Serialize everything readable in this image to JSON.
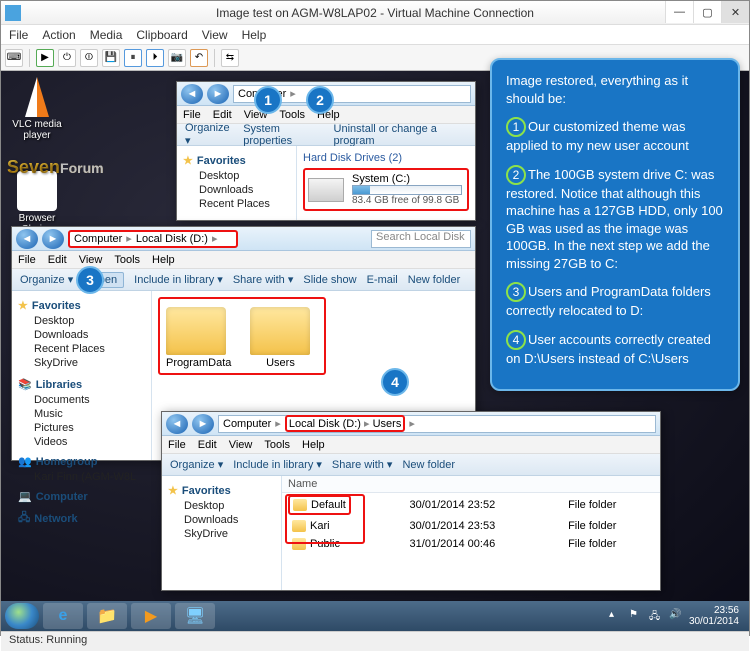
{
  "vm": {
    "title": "Image test on AGM-W8LAP02 - Virtual Machine Connection",
    "menu": [
      "File",
      "Action",
      "Media",
      "Clipboard",
      "View",
      "Help"
    ],
    "status": "Status: Running"
  },
  "desktop": {
    "icons": [
      {
        "label": "VLC media player"
      },
      {
        "label": "Browser Choice"
      }
    ],
    "brand": "Seven",
    "brand_tail": "Forum"
  },
  "taskbar": {
    "apps": [
      "ie",
      "explorer",
      "wmp",
      "vm"
    ],
    "time": "23:56",
    "date": "30/01/2014"
  },
  "explorer_computer": {
    "loc_prefix": "Computer",
    "search": "",
    "menu": [
      "File",
      "Edit",
      "View",
      "Tools",
      "Help"
    ],
    "cmd": [
      "Organize",
      "System properties",
      "Uninstall or change a program"
    ],
    "favorites_hdr": "Favorites",
    "fav_items": [
      "Desktop",
      "Downloads",
      "Recent Places"
    ],
    "section": "Hard Disk Drives (2)",
    "drive_name": "System (C:)",
    "drive_sub": "83.4 GB free of 99.8 GB",
    "drive_fill_pct": 16
  },
  "explorer_d": {
    "loc_segments": [
      "Computer",
      "Local Disk (D:)"
    ],
    "search_ph": "Search Local Disk",
    "menu": [
      "File",
      "Edit",
      "View",
      "Tools",
      "Help"
    ],
    "cmd": {
      "organize": "Organize",
      "open": "Open",
      "include": "Include in library",
      "share": "Share with",
      "slideshow": "Slide show",
      "email": "E-mail",
      "newfolder": "New folder"
    },
    "favorites_hdr": "Favorites",
    "fav_items": [
      "Desktop",
      "Downloads",
      "Recent Places",
      "SkyDrive"
    ],
    "libraries_hdr": "Libraries",
    "lib_items": [
      "Documents",
      "Music",
      "Pictures",
      "Videos"
    ],
    "homegroup_hdr": "Homegroup",
    "homegroup_items": [
      "Kari Finn (AGM-W8L"
    ],
    "computer_hdr": "Computer",
    "network_hdr": "Network",
    "folders": [
      "ProgramData",
      "Users"
    ]
  },
  "explorer_users": {
    "loc_segments": [
      "Computer",
      "Local Disk (D:)",
      "Users"
    ],
    "menu": [
      "File",
      "Edit",
      "View",
      "Tools",
      "Help"
    ],
    "cmd": {
      "organize": "Organize",
      "include": "Include in library",
      "share": "Share with",
      "newfolder": "New folder"
    },
    "favorites_hdr": "Favorites",
    "fav_items": [
      "Desktop",
      "Downloads",
      "SkyDrive"
    ],
    "col_name": "Name",
    "rows": [
      {
        "name": "Default",
        "date": "30/01/2014 23:52",
        "type": "File folder"
      },
      {
        "name": "Kari",
        "date": "30/01/2014 23:53",
        "type": "File folder"
      },
      {
        "name": "Public",
        "date": "31/01/2014 00:46",
        "type": "File folder"
      }
    ]
  },
  "callout": {
    "intro": "Image restored, everything as it should be:",
    "p1": "Our customized theme was applied to my new user account",
    "p2": "The 100GB system drive C: was restored. Notice that although this machine has a 127GB HDD, only 100 GB was used as the image was 100GB. In the next step we add the missing 27GB to C:",
    "p3": "Users and ProgramData folders correctly relocated to D:",
    "p4": "User accounts correctly created on D:\\Users instead of C:\\Users",
    "n1": "1",
    "n2": "2",
    "n3": "3",
    "n4": "4"
  }
}
